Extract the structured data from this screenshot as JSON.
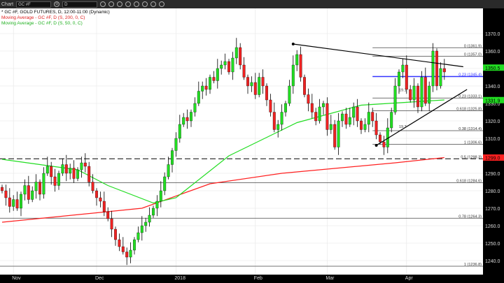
{
  "toolbar": {
    "title": "Chart",
    "symbol": "GC #F",
    "interval": "D"
  },
  "legend": {
    "main": "* GC #F, GOLD FUTURES, D, 12:00-11:00 (Dynamic)",
    "ma200": "Moving Average - GC #F, D (S, 200, 0, C)",
    "ma50": "Moving Average - GC #F, D (S, 50, 0, C)"
  },
  "colors": {
    "up": "#22dd22",
    "down": "#ee2222",
    "ma200": "#ff2020",
    "ma50": "#22dd22",
    "fib_blue": "#3333ff"
  },
  "chart_data": {
    "type": "candlestick",
    "ylim": [
      1232,
      1378
    ],
    "yticks": [
      1240,
      1250,
      1260,
      1270,
      1280,
      1290,
      1300,
      1310,
      1320,
      1330,
      1340,
      1350,
      1360,
      1370
    ],
    "x_labels": [
      {
        "label": "Nov",
        "index": 3
      },
      {
        "label": "Dec",
        "index": 25
      },
      {
        "label": "2018",
        "index": 46
      },
      {
        "label": "Feb",
        "index": 67
      },
      {
        "label": "Mar",
        "index": 86
      },
      {
        "label": "Apr",
        "index": 107
      }
    ],
    "close": [
      1280,
      1276,
      1271,
      1275,
      1270,
      1278,
      1283,
      1275,
      1280,
      1285,
      1278,
      1290,
      1294,
      1288,
      1283,
      1290,
      1295,
      1290,
      1293,
      1287,
      1292,
      1296,
      1294,
      1285,
      1280,
      1276,
      1274,
      1268,
      1264,
      1258,
      1252,
      1248,
      1245,
      1242,
      1246,
      1252,
      1256,
      1260,
      1262,
      1266,
      1270,
      1274,
      1280,
      1288,
      1295,
      1303,
      1310,
      1318,
      1322,
      1320,
      1325,
      1330,
      1337,
      1340,
      1338,
      1345,
      1343,
      1350,
      1352,
      1354,
      1348,
      1356,
      1362,
      1352,
      1345,
      1340,
      1342,
      1335,
      1345,
      1340,
      1332,
      1325,
      1315,
      1318,
      1325,
      1330,
      1340,
      1352,
      1358,
      1345,
      1335,
      1330,
      1325,
      1320,
      1328,
      1330,
      1315,
      1318,
      1305,
      1320,
      1324,
      1318,
      1322,
      1328,
      1320,
      1315,
      1318,
      1325,
      1320,
      1312,
      1308,
      1305,
      1316,
      1325,
      1340,
      1348,
      1352,
      1338,
      1332,
      1340,
      1328,
      1345,
      1330,
      1340,
      1360,
      1340,
      1350,
      1348
    ],
    "ma50": [
      [
        0,
        1298
      ],
      [
        20,
        1292
      ],
      [
        28,
        1283
      ],
      [
        40,
        1273
      ],
      [
        46,
        1276
      ],
      [
        60,
        1300
      ],
      [
        78,
        1319
      ],
      [
        95,
        1329
      ],
      [
        117,
        1332
      ]
    ],
    "ma200": [
      [
        0,
        1262
      ],
      [
        37,
        1270
      ],
      [
        55,
        1284
      ],
      [
        74,
        1290
      ],
      [
        104,
        1296
      ],
      [
        117,
        1299
      ]
    ],
    "fib_levels": [
      {
        "label": "0 (1361.9)",
        "value": 1361.9
      },
      {
        "label": "0 (1357.0)",
        "value": 1357.0
      },
      {
        "label": "0.23 (1345.4)",
        "value": 1345.4,
        "blue": true
      },
      {
        "label": "0.23 (1333.1)",
        "value": 1333.1
      },
      {
        "label": "0.618 (1325.8)",
        "value": 1325.8
      },
      {
        "label": "0.38 (1314.4)",
        "value": 1314.4
      },
      {
        "label": "1 (1306.6)",
        "value": 1306.6
      },
      {
        "label": "0.5 (1298.3)",
        "value": 1298.3,
        "dashed": true
      },
      {
        "label": "0.618 (1284.6)",
        "value": 1284.6
      },
      {
        "label": "0.78 (1264.3)",
        "value": 1264.3
      },
      {
        "label": "1 (1236.8)",
        "value": 1236.8
      }
    ],
    "annotations": [
      "19.1",
      "19.3"
    ],
    "price_tags": [
      {
        "value": 1350.5,
        "label": "1350.5",
        "color": "#22dd22"
      },
      {
        "value": 1331.9,
        "label": "1331.9",
        "color": "#22dd22"
      },
      {
        "value": 1299.0,
        "label": "1299.0",
        "color": "#ff2020"
      }
    ],
    "trendlines": [
      [
        [
          77,
          1364
        ],
        [
          122,
          1351
        ]
      ],
      [
        [
          99,
          1306
        ],
        [
          123,
          1338
        ]
      ]
    ]
  }
}
